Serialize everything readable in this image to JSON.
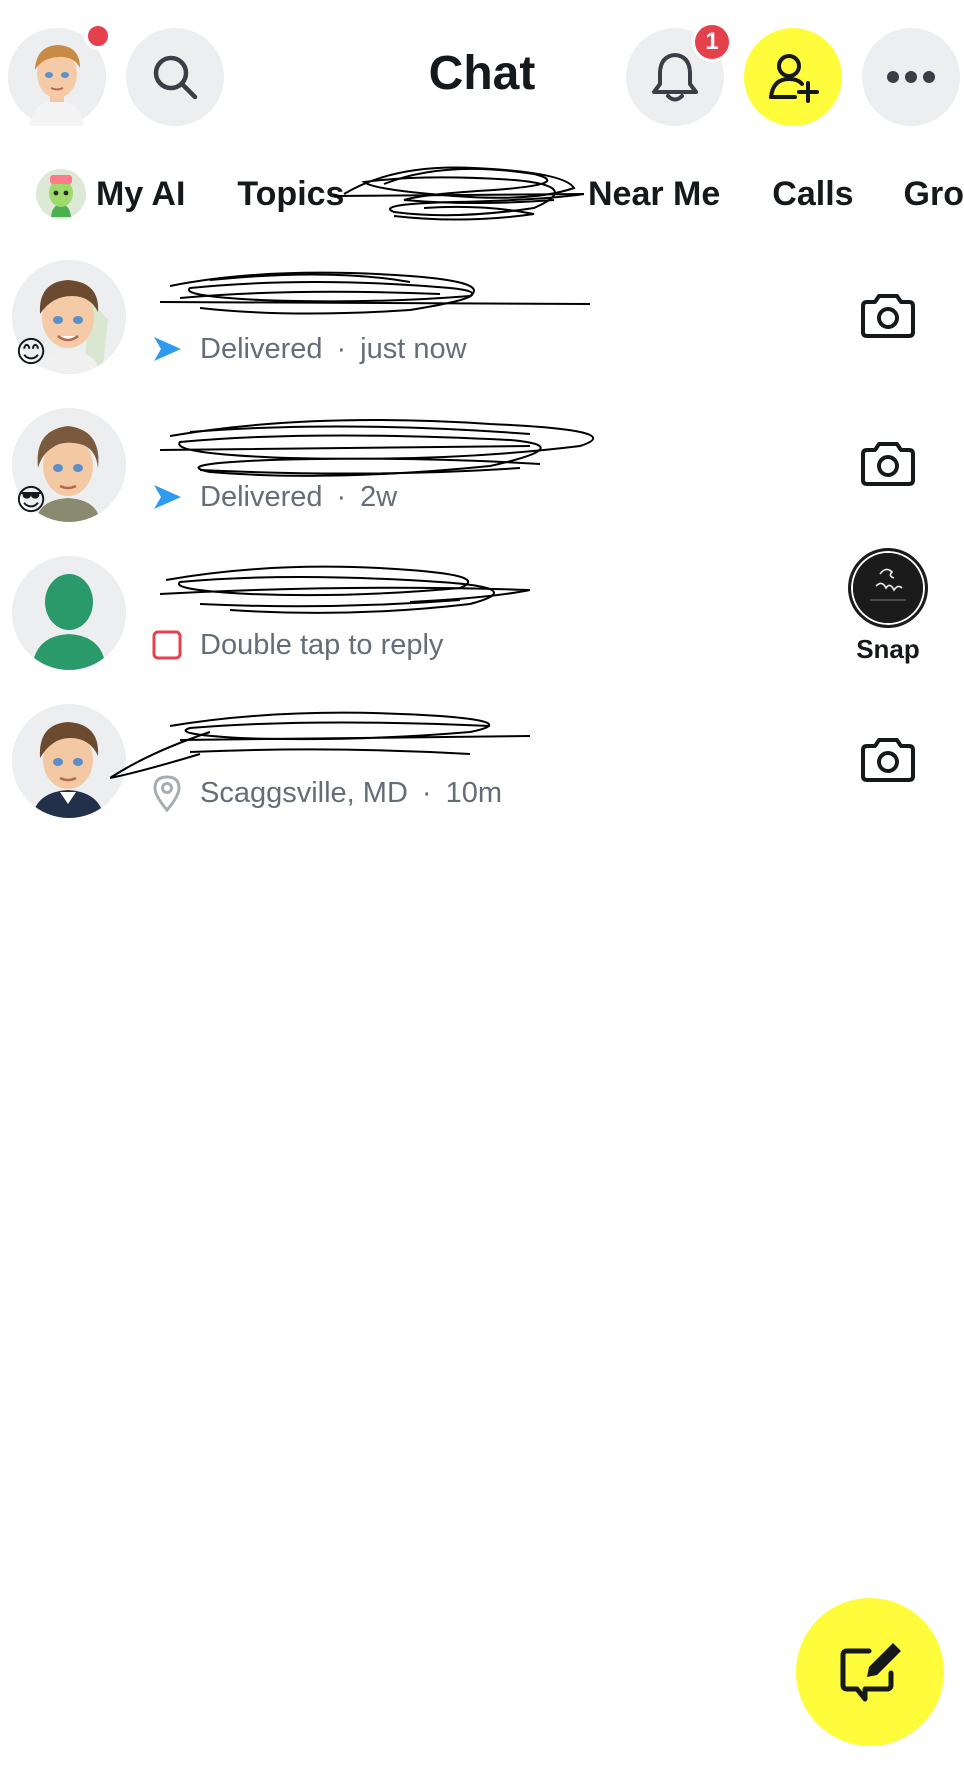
{
  "header": {
    "title": "Chat",
    "notification_count": "1",
    "icons": {
      "profile": "profile-avatar",
      "search": "search-icon",
      "notifications": "bell-icon",
      "add_friend": "add-friend-icon",
      "more": "more-icon"
    }
  },
  "tabs": [
    {
      "label": "My AI"
    },
    {
      "label": "Topics"
    },
    {
      "label": "Near Me"
    },
    {
      "label": "Calls"
    },
    {
      "label": "Gro"
    }
  ],
  "chats": [
    {
      "emoji": "😊",
      "status_icon": "sent-arrow-icon",
      "status": "Delivered",
      "time": "just now",
      "action": "camera-icon"
    },
    {
      "emoji": "😎",
      "status_icon": "sent-arrow-icon",
      "status": "Delivered",
      "time": "2w",
      "action": "camera-icon"
    },
    {
      "emoji": "",
      "status_icon": "unopened-chat-icon",
      "status": "Double tap to reply",
      "time": "",
      "action": "snap-thumbnail",
      "snap_label": "Snap"
    },
    {
      "emoji": "",
      "status_icon": "location-pin-icon",
      "status": "Scaggsville, MD",
      "time": "10m",
      "action": "camera-icon"
    }
  ],
  "colors": {
    "accent_yellow": "#fffc3b",
    "badge_red": "#e5414d",
    "sent_blue": "#2f9bf0",
    "unread_red": "#e5414d",
    "secondary_text": "#656d78",
    "button_gray": "#eceef0"
  },
  "fab": {
    "icon": "new-chat-icon"
  }
}
